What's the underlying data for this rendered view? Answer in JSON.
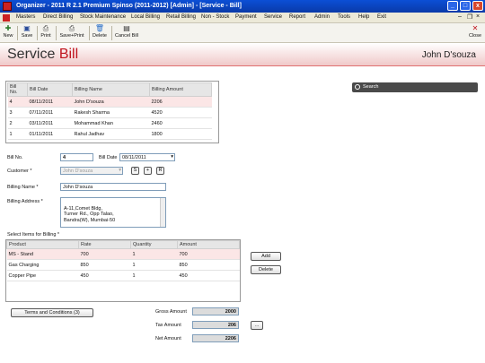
{
  "window": {
    "title": "Organizer - 2011 R 2.1 Premium Spinso (2011-2012) [Admin] - [Service - Bill]",
    "min": "_",
    "max": "□",
    "close": "x"
  },
  "menu": [
    "Masters",
    "Direct Billing",
    "Stock Maintenance",
    "Local Billing",
    "Retail Billing",
    "Non - Stock",
    "Payment",
    "Service",
    "Report",
    "Admin",
    "Tools",
    "Help",
    "Exit"
  ],
  "toolbar": {
    "new": "New",
    "save": "Save",
    "print": "Print",
    "save_print": "Save+Print",
    "delete": "Delete",
    "cancel_bill": "Cancel Bill",
    "close": "Close"
  },
  "header": {
    "title_part1": "Service",
    "title_part2": "Bill",
    "customer": "John D'souza"
  },
  "search": {
    "placeholder": "Search"
  },
  "bill_list": {
    "columns": [
      "Bill No.",
      "Bill Date",
      "Billing Name",
      "Billing Amount"
    ],
    "rows": [
      [
        "4",
        "08/11/2011",
        "John D'souza",
        "2206"
      ],
      [
        "3",
        "07/11/2011",
        "Rakesh Sharma",
        "4520"
      ],
      [
        "2",
        "03/11/2011",
        "Mohammad Khan",
        "2460"
      ],
      [
        "1",
        "01/11/2011",
        "Rahul Jadhav",
        "1800"
      ]
    ]
  },
  "form": {
    "bill_no_label": "Bill No.",
    "bill_no": "4",
    "bill_date_label": "Bill Date",
    "bill_date": "08/11/2011",
    "customer_label": "Customer *",
    "customer": "John D'souza",
    "btn_s": "S",
    "btn_plus": "+",
    "btn_r": "R",
    "billing_name_label": "Billing Name *",
    "billing_name": "John D'souza",
    "billing_address_label": "Billing Address *",
    "billing_address": "A-11,Comet Bldg,\nTurner Rd., Opp Talao,\nBandra(W), Mumbai-50"
  },
  "items": {
    "label": "Select Items for Billing *",
    "columns": [
      "Product",
      "Rate",
      "Quantity",
      "Amount"
    ],
    "rows": [
      [
        "MS - Stand",
        "700",
        "1",
        "700"
      ],
      [
        "Gas Charging",
        "850",
        "1",
        "850"
      ],
      [
        "Copper Pipe",
        "450",
        "1",
        "450"
      ]
    ],
    "add": "Add",
    "delete": "Delete"
  },
  "totals": {
    "terms": "Terms and Conditions (3)",
    "gross_label": "Gross Amount",
    "gross": "2000",
    "tax_label": "Tax Amount",
    "tax": "206",
    "tax_btn": "...",
    "net_label": "Net Amount",
    "net": "2206"
  }
}
